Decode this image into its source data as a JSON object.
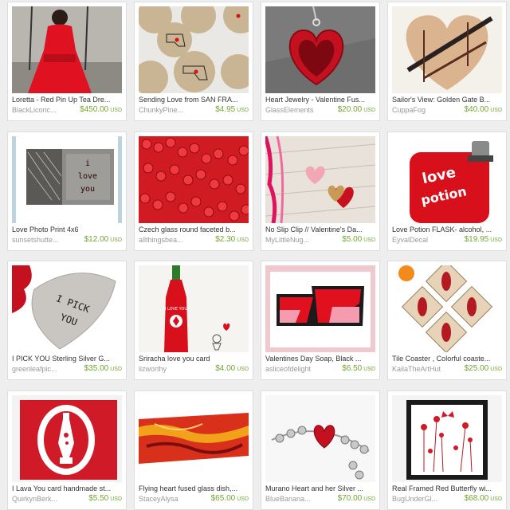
{
  "listings": [
    {
      "title": "Loretta - Red Pin Up Tea Dre...",
      "shop": "BlackLicoric...",
      "price": "$450.00",
      "currency": "USD"
    },
    {
      "title": "Sending Love from SAN FRA...",
      "shop": "ChunkyPine...",
      "price": "$4.95",
      "currency": "USD"
    },
    {
      "title": "Heart Jewelry - Valentine Fus...",
      "shop": "GlassElements",
      "price": "$20.00",
      "currency": "USD"
    },
    {
      "title": "Sailor's View: Golden Gate B...",
      "shop": "CuppaFog",
      "price": "$40.00",
      "currency": "USD"
    },
    {
      "title": "Love Photo Print 4x6",
      "shop": "sunsetshutte...",
      "price": "$12.00",
      "currency": "USD",
      "image_text": "i love you"
    },
    {
      "title": "Czech glass round faceted b...",
      "shop": "allthingsbea...",
      "price": "$2.30",
      "currency": "USD"
    },
    {
      "title": "No Slip Clip // Valentine's Da...",
      "shop": "MyLittleNug...",
      "price": "$5.00",
      "currency": "USD"
    },
    {
      "title": "Love Potion FLASK- alcohol, ...",
      "shop": "EyvalDecal",
      "price": "$19.95",
      "currency": "USD",
      "image_text": "love potion"
    },
    {
      "title": "I PICK YOU Sterling Silver G...",
      "shop": "greenleafpic...",
      "price": "$35.00",
      "currency": "USD",
      "image_text": "I PICK YOU"
    },
    {
      "title": "Sriracha love you card",
      "shop": "lizworthy",
      "price": "$4.00",
      "currency": "USD",
      "image_text": "I LOVE YOU"
    },
    {
      "title": "Valentines Day Soap, Black ...",
      "shop": "asliceofdelight",
      "price": "$6.50",
      "currency": "USD"
    },
    {
      "title": "Tile Coaster , Colorful coaste...",
      "shop": "KailaTheArtHut",
      "price": "$25.00",
      "currency": "USD"
    },
    {
      "title": "I Lava You card handmade st...",
      "shop": "QuirkynBerk...",
      "price": "$5.50",
      "currency": "USD"
    },
    {
      "title": "Flying heart fused glass dish,...",
      "shop": "StaceyAlysa",
      "price": "$65.00",
      "currency": "USD"
    },
    {
      "title": "Murano Heart and her Silver ...",
      "shop": "BlueBanana...",
      "price": "$70.00",
      "currency": "USD"
    },
    {
      "title": "Real Framed Red Butterfly wi...",
      "shop": "BugUnderGl...",
      "price": "$68.00",
      "currency": "USD"
    }
  ],
  "colors": {
    "price": "#74a534",
    "title": "#333333",
    "shop": "#999999",
    "accent": "#d8101b"
  }
}
